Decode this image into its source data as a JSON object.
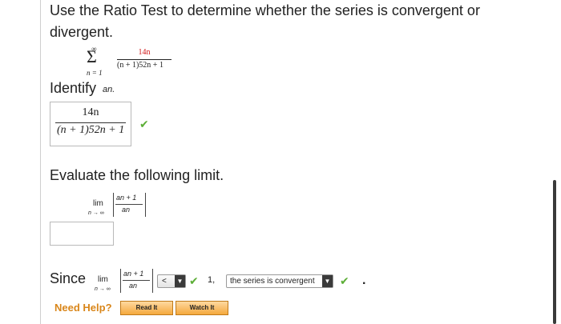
{
  "prompt": "Use the Ratio Test to determine whether the series is convergent or divergent.",
  "series": {
    "sigma": "Σ",
    "upper": "∞",
    "lower": "n = 1",
    "numerator": "14n",
    "denominator": "(n + 1)52n + 1"
  },
  "identify": {
    "label": "Identify",
    "symbol": "an.",
    "answer_numerator": "14n",
    "answer_denominator": "(n + 1)52n + 1",
    "check": "✔"
  },
  "evaluate": {
    "label": "Evaluate the following limit.",
    "lim": "lim",
    "lim_sub": "n → ∞",
    "frac_num": "an + 1",
    "frac_den": "an",
    "input_value": ""
  },
  "since": {
    "label": "Since",
    "lim": "lim",
    "lim_sub": "n → ∞",
    "frac_num": "an + 1",
    "frac_den": "an",
    "comparison_value": "<",
    "check1": "✔",
    "value": "1,",
    "conclusion_value": "the series is convergent",
    "check2": "✔",
    "period": "."
  },
  "help": {
    "label": "Need Help?",
    "read_button": "Read It",
    "watch_button": "Watch It"
  },
  "colors": {
    "accent_red": "#d01818",
    "check_green": "#5cae36",
    "help_orange": "#d9861a"
  }
}
